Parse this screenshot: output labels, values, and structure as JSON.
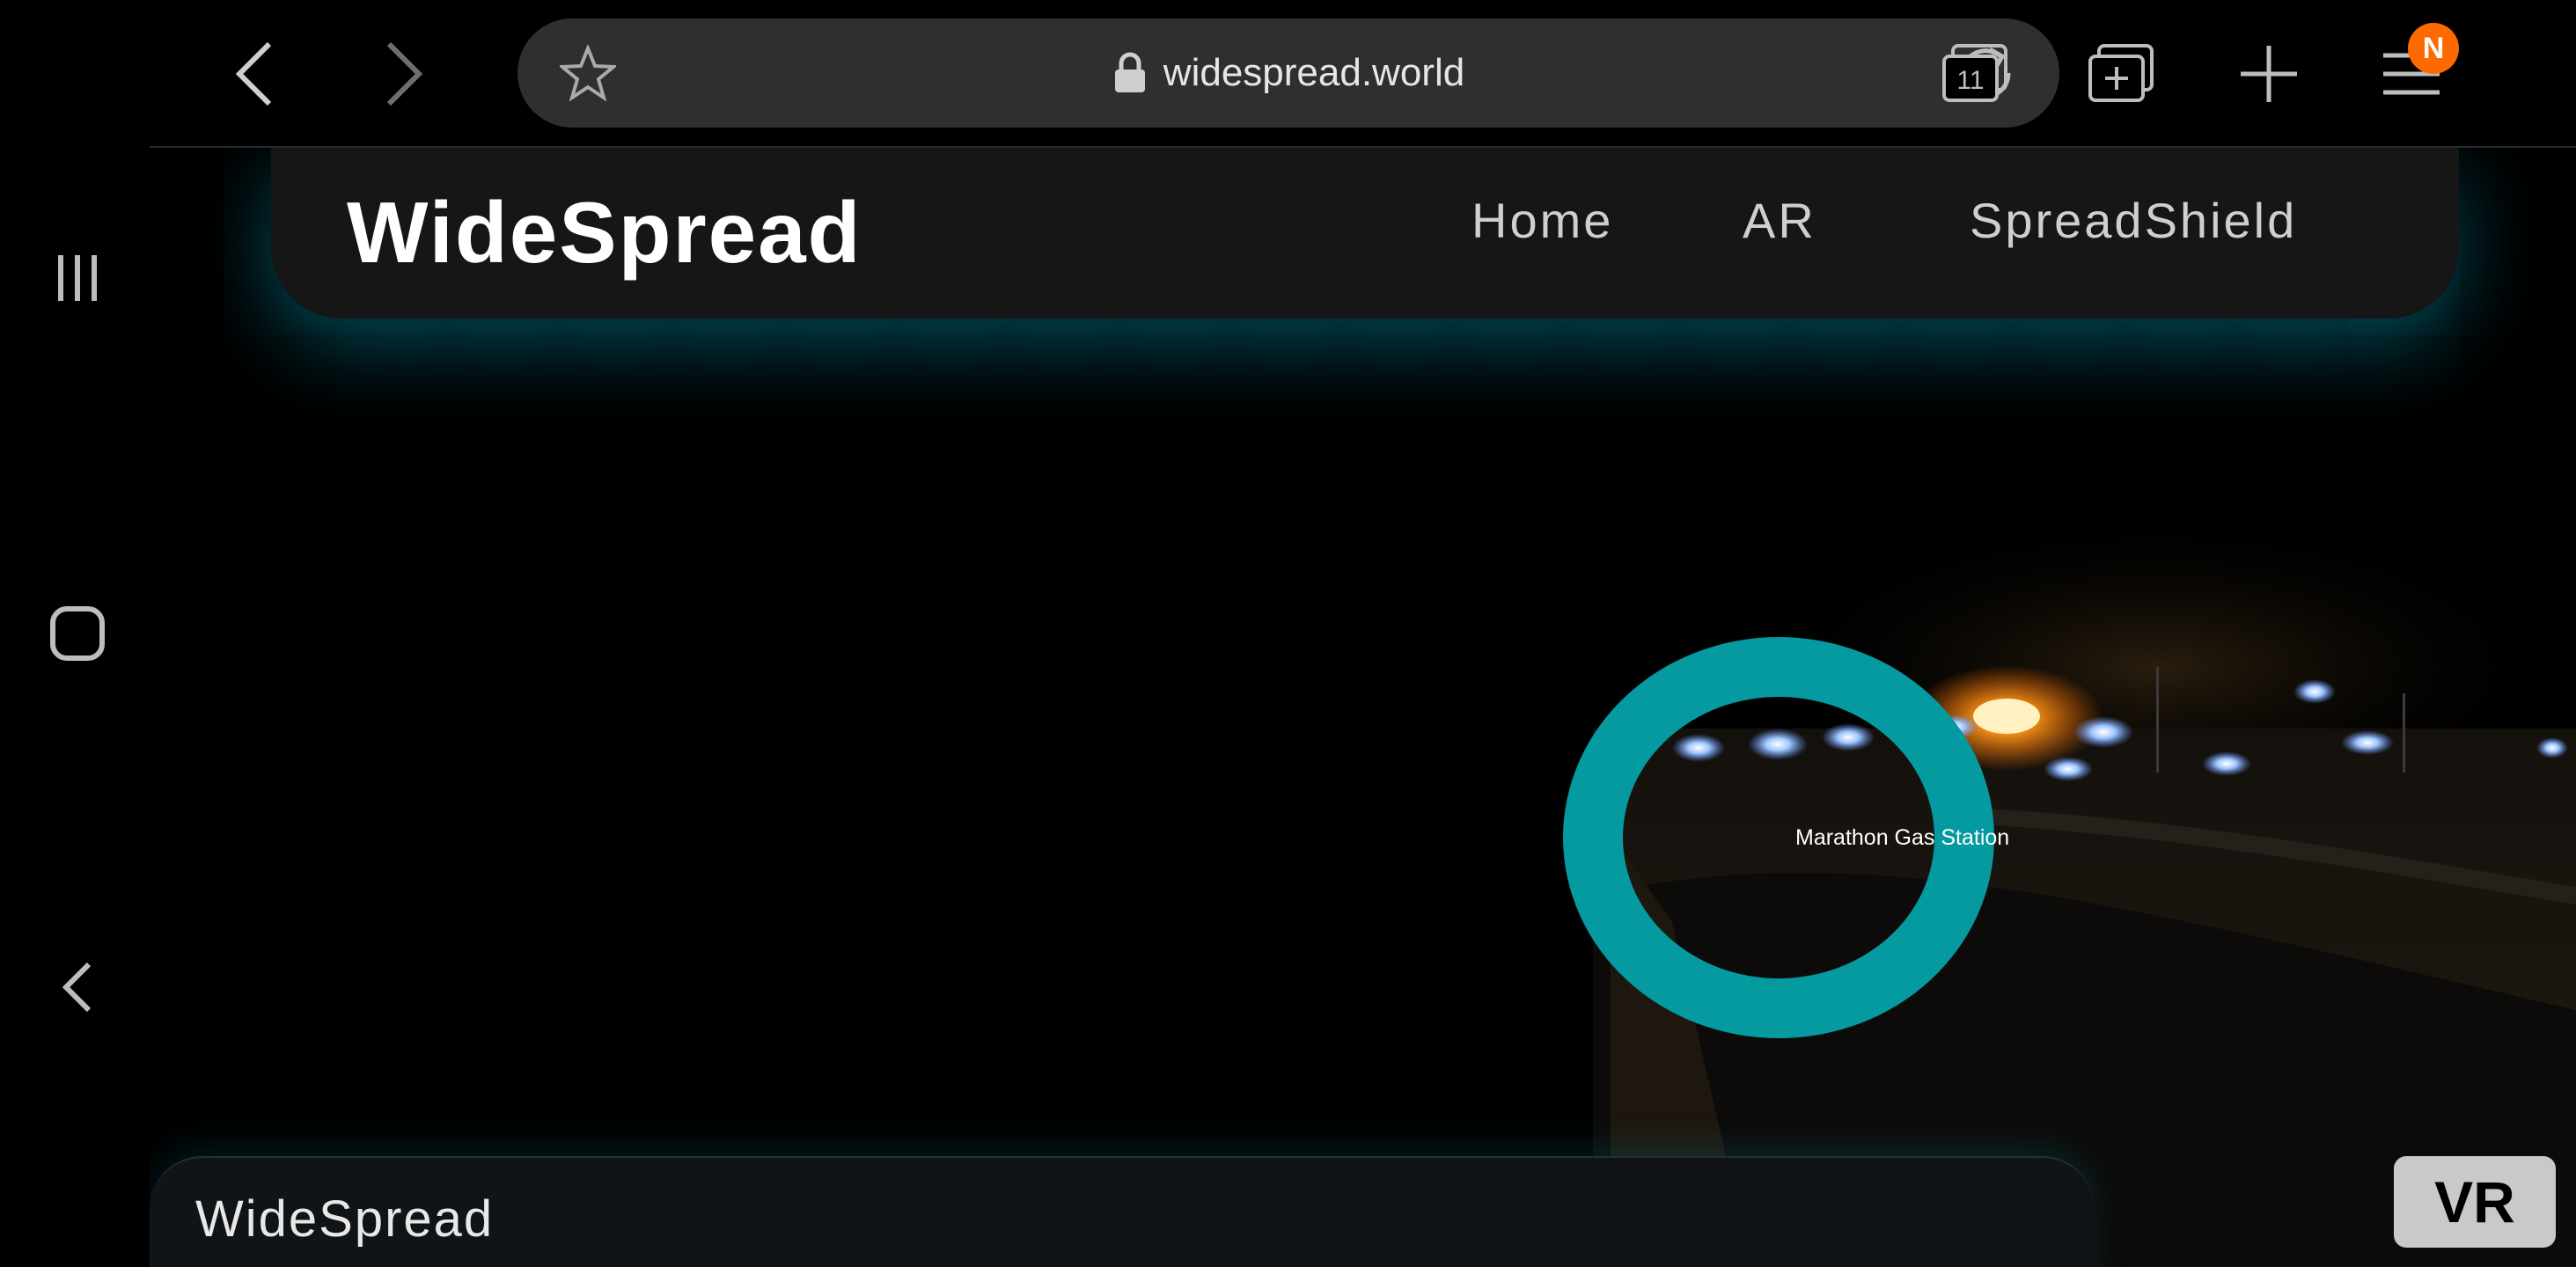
{
  "browser": {
    "url": "widespread.world",
    "tab_count": "11",
    "profile_initial": "N"
  },
  "site": {
    "brand": "WideSpread",
    "nav": [
      "Home",
      "AR",
      "SpreadShield"
    ]
  },
  "ar": {
    "marker_label": "Marathon Gas Station",
    "marker_color": "#049aa0"
  },
  "footer": {
    "brand": "WideSpread"
  },
  "vr_button": {
    "label": "VR"
  },
  "colors": {
    "accent_glow": "#00aac8",
    "profile_badge": "#ff6a00"
  }
}
